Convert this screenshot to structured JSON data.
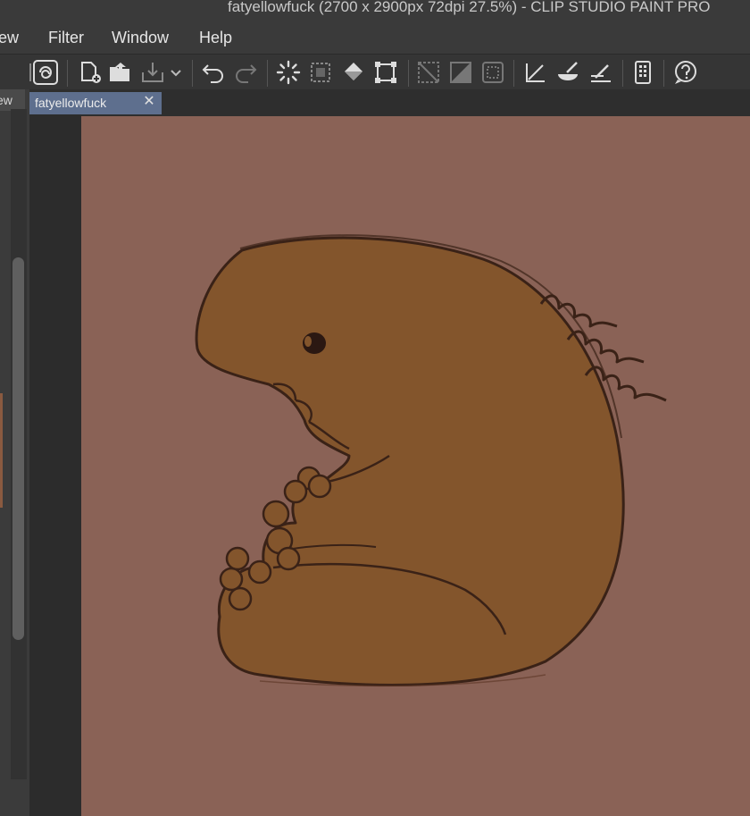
{
  "window": {
    "title": "fatyellowfuck (2700 x 2900px 72dpi 27.5%)  - CLIP STUDIO PAINT PRO"
  },
  "menu": {
    "items": [
      "ew",
      "Filter",
      "Window",
      "Help"
    ]
  },
  "panels": {
    "left_tab_label": "ew"
  },
  "document": {
    "tab_label": "fatyellowfuck",
    "close_glyph": "✕"
  },
  "colors": {
    "canvas_background": "#8a6256",
    "creature_fill": "#83552c",
    "line_art": "#3a2217",
    "doc_tab_active": "#5e6f8e"
  },
  "toolbar": {
    "icons": [
      "clip-studio-logo-icon",
      "new-canvas-icon",
      "open-folder-icon",
      "export-icon",
      "dropdown-chevron-icon",
      "undo-icon",
      "redo-icon",
      "loading-spinner-icon",
      "select-all-icon",
      "fill-icon",
      "transform-icon",
      "clear-selection-icon",
      "invert-selection-icon",
      "show-selection-icon",
      "ruler-icon",
      "brush-icon",
      "line-icon",
      "device-icon",
      "help-icon"
    ]
  }
}
